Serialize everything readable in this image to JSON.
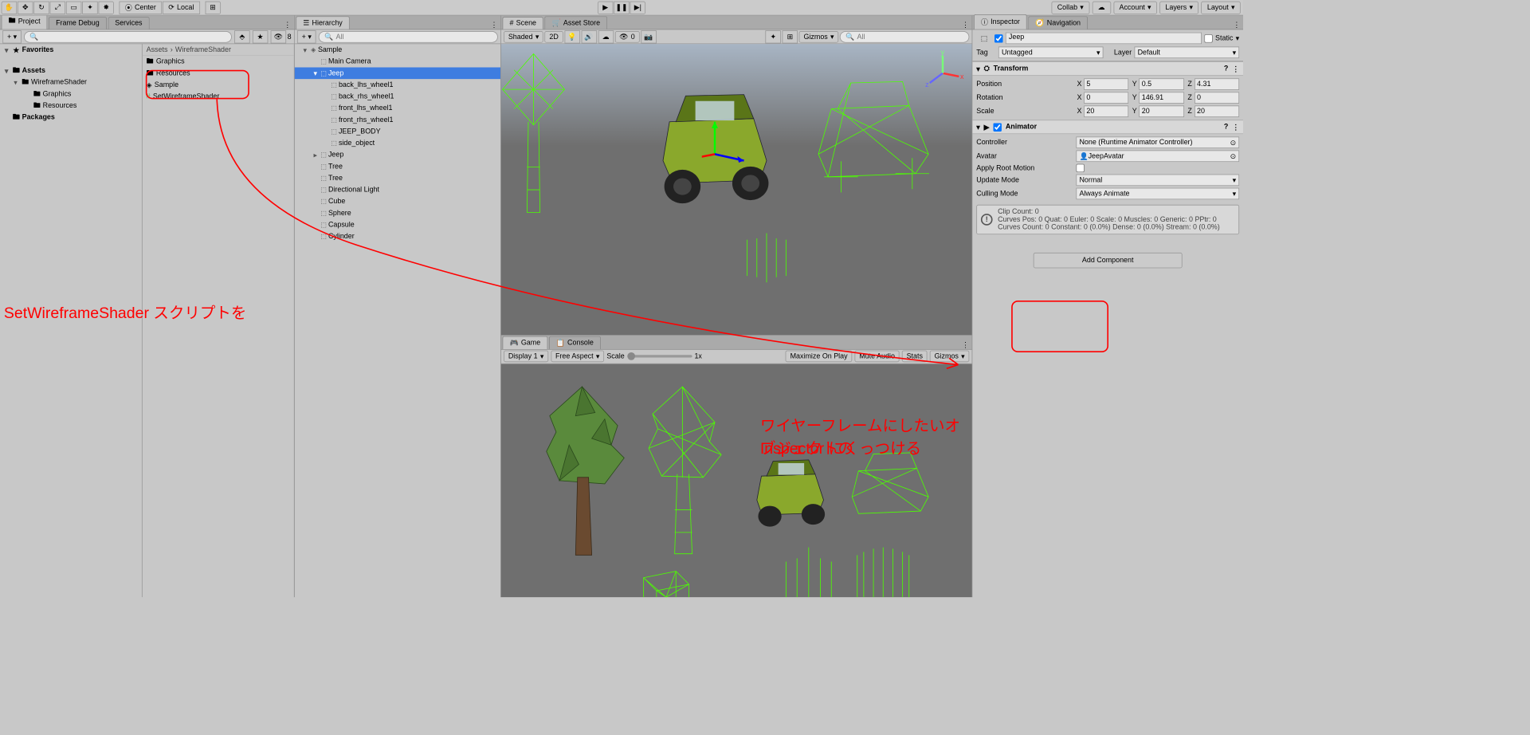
{
  "toolbar": {
    "center_label": "Center",
    "local_label": "Local",
    "collab_label": "Collab",
    "account_label": "Account",
    "layers_label": "Layers",
    "layout_label": "Layout"
  },
  "project": {
    "tabs": [
      "Project",
      "Frame Debug",
      "Services"
    ],
    "favorites": "Favorites",
    "assets_root": "Assets",
    "tree": [
      {
        "label": "WireframeShader",
        "depth": 1,
        "open": true
      },
      {
        "label": "Graphics",
        "depth": 2
      },
      {
        "label": "Resources",
        "depth": 2
      }
    ],
    "packages_root": "Packages",
    "breadcrumb": [
      "Assets",
      "WireframeShader"
    ],
    "items": [
      {
        "label": "Graphics",
        "type": "folder"
      },
      {
        "label": "Resources",
        "type": "folder"
      },
      {
        "label": "Sample",
        "type": "scene"
      },
      {
        "label": "SetWireframeShader",
        "type": "script"
      }
    ],
    "search_count": "8"
  },
  "hierarchy": {
    "tab": "Hierarchy",
    "search_placeholder": "All",
    "items": [
      {
        "label": "Sample",
        "depth": 0,
        "fold": "▾",
        "ico": "◈"
      },
      {
        "label": "Main Camera",
        "depth": 1,
        "ico": "⬚"
      },
      {
        "label": "Jeep",
        "depth": 1,
        "fold": "▾",
        "ico": "⬚",
        "selected": true
      },
      {
        "label": "back_lhs_wheel1",
        "depth": 2,
        "ico": "⬚"
      },
      {
        "label": "back_rhs_wheel1",
        "depth": 2,
        "ico": "⬚"
      },
      {
        "label": "front_lhs_wheel1",
        "depth": 2,
        "ico": "⬚"
      },
      {
        "label": "front_rhs_wheel1",
        "depth": 2,
        "ico": "⬚"
      },
      {
        "label": "JEEP_BODY",
        "depth": 2,
        "ico": "⬚"
      },
      {
        "label": "side_object",
        "depth": 2,
        "ico": "⬚"
      },
      {
        "label": "Jeep",
        "depth": 1,
        "fold": "▸",
        "ico": "⬚"
      },
      {
        "label": "Tree",
        "depth": 1,
        "ico": "⬚"
      },
      {
        "label": "Tree",
        "depth": 1,
        "ico": "⬚"
      },
      {
        "label": "Directional Light",
        "depth": 1,
        "ico": "⬚"
      },
      {
        "label": "Cube",
        "depth": 1,
        "ico": "⬚"
      },
      {
        "label": "Sphere",
        "depth": 1,
        "ico": "⬚"
      },
      {
        "label": "Capsule",
        "depth": 1,
        "ico": "⬚"
      },
      {
        "label": "Cylinder",
        "depth": 1,
        "ico": "⬚"
      }
    ]
  },
  "scene": {
    "tab_scene": "Scene",
    "tab_asset": "Asset Store",
    "shading": "Shaded",
    "mode2d": "2D",
    "gizmos": "Gizmos",
    "skybox_count": "0",
    "search_placeholder": "All"
  },
  "game": {
    "tab_game": "Game",
    "tab_console": "Console",
    "display": "Display 1",
    "aspect": "Free Aspect",
    "scale": "Scale",
    "scale_val": "1x",
    "maximize": "Maximize On Play",
    "mute": "Mute Audio",
    "stats": "Stats",
    "gizmos": "Gizmos"
  },
  "inspector": {
    "tab_inspector": "Inspector",
    "tab_navigation": "Navigation",
    "name": "Jeep",
    "static_label": "Static",
    "tag_label": "Tag",
    "tag_value": "Untagged",
    "layer_label": "Layer",
    "layer_value": "Default",
    "transform": {
      "title": "Transform",
      "position_label": "Position",
      "position": {
        "x": "5",
        "y": "0.5",
        "z": "4.31"
      },
      "rotation_label": "Rotation",
      "rotation": {
        "x": "0",
        "y": "146.91",
        "z": "0"
      },
      "scale_label": "Scale",
      "scale": {
        "x": "20",
        "y": "20",
        "z": "20"
      }
    },
    "animator": {
      "title": "Animator",
      "controller_label": "Controller",
      "controller_value": "None (Runtime Animator Controller)",
      "avatar_label": "Avatar",
      "avatar_value": "JeepAvatar",
      "apply_root_label": "Apply Root Motion",
      "update_mode_label": "Update Mode",
      "update_mode_value": "Normal",
      "culling_mode_label": "Culling Mode",
      "culling_mode_value": "Always Animate",
      "info_l1": "Clip Count: 0",
      "info_l2": "Curves Pos: 0 Quat: 0 Euler: 0 Scale: 0 Muscles: 0 Generic: 0 PPtr: 0",
      "info_l3": "Curves Count: 0 Constant: 0 (0.0%) Dense: 0 (0.0%) Stream: 0 (0.0%)"
    },
    "add_component": "Add Component"
  },
  "annotations": {
    "line1": "SetWireframeShader スクリプトを",
    "line2": "ワイヤーフレームにしたいオブジェクトの",
    "line3": "Inspector にくっつける"
  }
}
